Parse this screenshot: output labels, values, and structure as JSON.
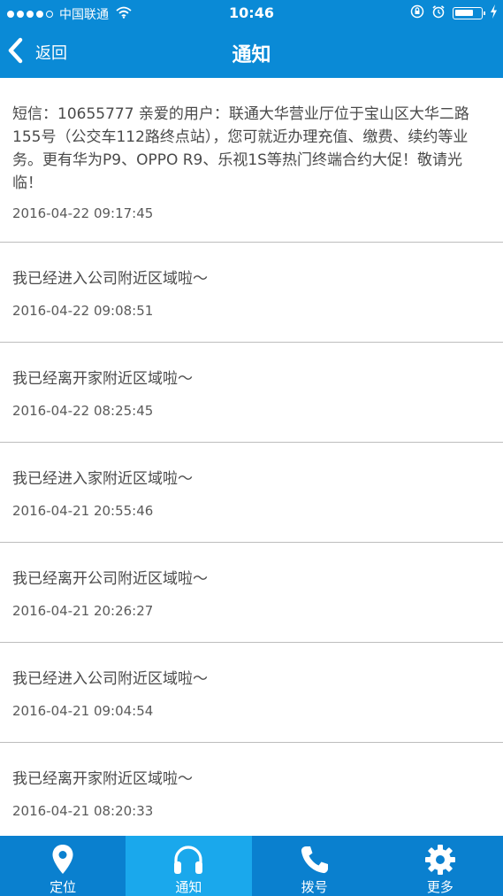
{
  "status_bar": {
    "carrier": "中国联通",
    "time": "10:46",
    "signal_dots_filled": 4,
    "signal_dots_total": 5,
    "battery_level": 0.75,
    "icons": [
      "wifi-icon",
      "rotation-lock-icon",
      "alarm-icon",
      "battery-icon",
      "charging-icon"
    ]
  },
  "nav": {
    "back_label": "返回",
    "title": "通知",
    "back_icon": "chevron-left-icon"
  },
  "notifications": [
    {
      "message": "短信：10655777 亲爱的用户：联通大华营业厅位于宝山区大华二路155号（公交车112路终点站），您可就近办理充值、缴费、续约等业务。更有华为P9、OPPO R9、乐视1S等热门终端合约大促！敬请光临！",
      "time": "2016-04-22 09:17:45"
    },
    {
      "message": "我已经进入公司附近区域啦～",
      "time": "2016-04-22 09:08:51"
    },
    {
      "message": "我已经离开家附近区域啦～",
      "time": "2016-04-22 08:25:45"
    },
    {
      "message": "我已经进入家附近区域啦～",
      "time": "2016-04-21 20:55:46"
    },
    {
      "message": "我已经离开公司附近区域啦～",
      "time": "2016-04-21 20:26:27"
    },
    {
      "message": "我已经进入公司附近区域啦～",
      "time": "2016-04-21 09:04:54"
    },
    {
      "message": "我已经离开家附近区域啦～",
      "time": "2016-04-21 08:20:33"
    }
  ],
  "tabs": [
    {
      "label": "定位",
      "icon": "location-pin-icon",
      "active": false
    },
    {
      "label": "通知",
      "icon": "headphones-icon",
      "active": true
    },
    {
      "label": "拨号",
      "icon": "phone-icon",
      "active": false
    },
    {
      "label": "更多",
      "icon": "gear-icon",
      "active": false
    }
  ],
  "colors": {
    "primary": "#0a8ad6",
    "tab_active": "#1aa8ec",
    "divider": "#bdbdbd",
    "text": "#4a4a4a"
  }
}
